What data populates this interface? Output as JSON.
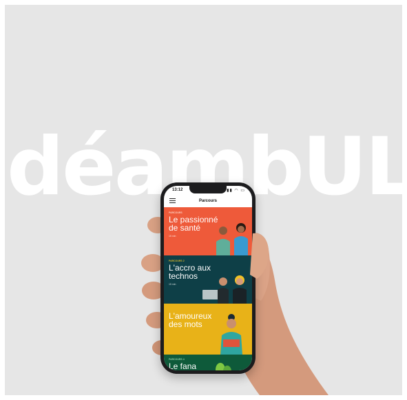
{
  "brand": {
    "wordmark": "déambUL"
  },
  "phone": {
    "status_time": "13:12",
    "status_icons": "▮▮ ◠ ▭",
    "nav_title": "Parcours"
  },
  "cards": [
    {
      "kicker": "PARCOURS",
      "title_line1": "Le passionné",
      "title_line2": "de santé",
      "tag": "15 min",
      "color": "#ee5a3a"
    },
    {
      "kicker": "PARCOURS 2",
      "title_line1": "L'accro aux",
      "title_line2": "technos",
      "tag": "15 min",
      "color": "#0e3f47"
    },
    {
      "kicker": "",
      "title_line1": "L'amoureux",
      "title_line2": "des mots",
      "tag": "",
      "color": "#e8b218"
    },
    {
      "kicker": "PARCOURS 4",
      "title_line1": "Le fana",
      "title_line2": "",
      "tag": "",
      "color": "#0e5a3a"
    }
  ],
  "colors": {
    "background": "#e6e6e6",
    "phone_body": "#1c1c1e",
    "skin": "#d9a184"
  }
}
